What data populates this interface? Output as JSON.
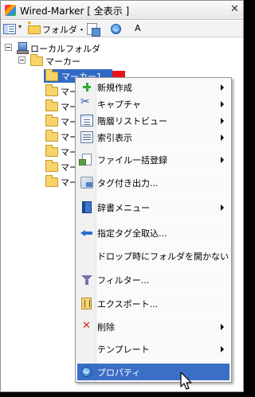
{
  "window": {
    "title": "Wired-Marker [ 全表示 ]",
    "close_glyph": "✕"
  },
  "toolbar": {
    "folder_label": "フォルダ・",
    "dropdown_glyph": "▾",
    "overflow_label": "A"
  },
  "tree": {
    "root_label": "ローカルフォルダ",
    "group_label": "マーカー",
    "selected_label": "マーカー1",
    "marker_color": "#e8141d",
    "child_labels": [
      "マー",
      "マー",
      "マー",
      "マー",
      "マー",
      "マー",
      "マー"
    ]
  },
  "context_menu": {
    "items": [
      {
        "label": "新規作成",
        "icon": "plus-icon",
        "submenu": true
      },
      {
        "label": "キャプチャ",
        "icon": "scissors-icon",
        "submenu": true
      },
      {
        "label": "階層リストビュー",
        "icon": "tree-list-icon",
        "submenu": true
      },
      {
        "label": "索引表示",
        "icon": "index-icon",
        "submenu": true
      },
      {
        "label": "ファイル一括登録",
        "icon": "file-import-icon",
        "submenu": true
      },
      {
        "label": "タグ付き出力...",
        "icon": "tag-output-icon",
        "submenu": false
      },
      {
        "label": "辞書メニュー",
        "icon": "dictionary-icon",
        "submenu": true
      },
      {
        "label": "指定タグ全取込...",
        "icon": "tag-import-icon",
        "submenu": false
      },
      {
        "label": "ドロップ時にフォルダを開かない",
        "icon": "",
        "submenu": false
      },
      {
        "label": "フィルター...",
        "icon": "filter-icon",
        "submenu": false
      },
      {
        "label": "エクスポート...",
        "icon": "export-icon",
        "submenu": false
      },
      {
        "label": "削除",
        "icon": "delete-icon",
        "submenu": true
      },
      {
        "label": "テンプレート",
        "icon": "",
        "submenu": true
      },
      {
        "label": "プロパティ",
        "icon": "properties-icon",
        "submenu": false,
        "highlighted": true
      }
    ]
  },
  "colors": {
    "selection": "#316ac5",
    "menu_highlight": "#3a6ec7"
  }
}
